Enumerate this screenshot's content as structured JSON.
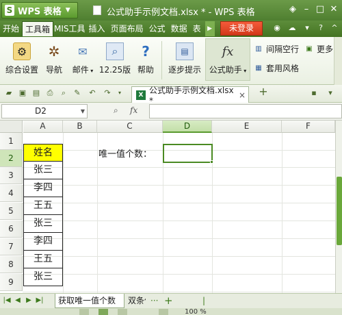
{
  "titlebar": {
    "app_logo": "S",
    "app_name": "WPS 表格",
    "title": "公式助手示例文档.xlsx * - WPS 表格"
  },
  "menu": {
    "items": [
      "开始",
      "工具箱",
      "MIS工具",
      "插入",
      "页面布局",
      "公式",
      "数据",
      "表"
    ],
    "active_index": 1,
    "login_label": "未登录"
  },
  "ribbon": {
    "buttons": [
      {
        "label": "综合设置",
        "icon": "settings-icon"
      },
      {
        "label": "导航",
        "icon": "wheel-icon"
      },
      {
        "label": "邮件",
        "icon": "mail-icon"
      },
      {
        "label": "12.25版",
        "icon": "version-icon"
      },
      {
        "label": "帮助",
        "icon": "help-icon"
      },
      {
        "label": "逐步提示",
        "icon": "step-tip-icon"
      },
      {
        "label": "公式助手",
        "icon": "fx-icon"
      }
    ],
    "small": [
      {
        "label": "间隔空行",
        "icon": "interval-row-icon"
      },
      {
        "label": "更多",
        "icon": "more-icon"
      },
      {
        "label": "套用风格",
        "icon": "style-icon"
      }
    ]
  },
  "quickbar": {
    "doc_tab_label": "公式助手示例文档.xlsx *",
    "doc_tab_icon": "X"
  },
  "formulabar": {
    "cell_ref": "D2",
    "fx_label": "fx",
    "formula": ""
  },
  "grid": {
    "columns": [
      "A",
      "B",
      "C",
      "D",
      "E",
      "F"
    ],
    "active_column": "D",
    "rows": [
      "1",
      "2",
      "3",
      "4",
      "5",
      "6",
      "7",
      "8",
      "9"
    ],
    "active_row": "2",
    "column_a_header": "姓名",
    "column_a_values": [
      "张三",
      "李四",
      "王五",
      "张三",
      "李四",
      "王五",
      "张三"
    ],
    "label_c2": "唯一值个数：",
    "active_cell_value": ""
  },
  "sheets": {
    "active": "获取唯一值个数",
    "other": "双条件"
  },
  "status": {
    "zoom": "100 %"
  }
}
